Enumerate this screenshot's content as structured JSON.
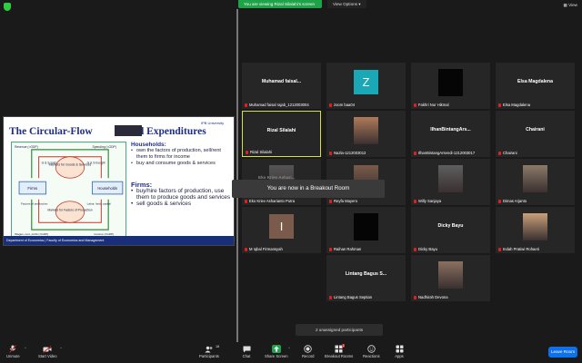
{
  "top": {
    "viewing_banner": "You are viewing Rizal Silalahi's screen",
    "view_options": "View Options",
    "view_button": "View"
  },
  "slide": {
    "title_left": "The Circular-Flow",
    "title_right": "and Expenditures",
    "logo_text": "IPB University",
    "diagram": {
      "revenue": "Revenue (=GDP)",
      "spending": "Spending (=GDP)",
      "gs_sold": "G & S sold",
      "gs_bought": "G & S bought",
      "markets_goods": "Markets for Goods & Services",
      "firms": "Firms",
      "households": "Households",
      "factors_production": "Factors of production",
      "labor": "Labor, land, capital",
      "markets_factors": "Markets for Factors of Production",
      "wages": "Wages, rent, profit (=GDP)",
      "income": "Income (=GDP)"
    },
    "households_title": "Households:",
    "households_bullets": [
      "own the factors of production, sell/rent them to firms for income",
      "buy and consume goods & services"
    ],
    "firms_title": "Firms:",
    "firms_bullets": [
      "buy/hire factors of production, use them to produce goods and services",
      "sell goods & services"
    ],
    "footer": "Department of Economics | Faculty of Economics and Management"
  },
  "tiles": [
    {
      "center": "Muhamad  faisal...",
      "label": "Muhamad faisal rajab_1212003004",
      "kind": "name"
    },
    {
      "center": "Z",
      "label": "zoom baa04",
      "kind": "avatar",
      "color": "#1ba8b6"
    },
    {
      "center": "",
      "label": "Fakhri Nur Hikmal",
      "kind": "black"
    },
    {
      "center": "Elsa Magdalena",
      "label": "Elsa Magdalena",
      "kind": "name"
    },
    {
      "center": "Rizal Silalahi",
      "label": "Rizal Silalahi",
      "kind": "name",
      "active": true
    },
    {
      "center": "",
      "label": "Nazla-1212003013",
      "kind": "photo",
      "color": "#b07a5a"
    },
    {
      "center": "IlhanBintangArs...",
      "label": "IlhanBintangArsendi-1212003017",
      "kind": "name"
    },
    {
      "center": "Chairani",
      "label": "Chairani",
      "kind": "name"
    },
    {
      "center": "",
      "label": "Eko Kriev Asharianto Putra",
      "kind": "photo",
      "color": "#555"
    },
    {
      "center": "",
      "label": "Reyfa Mayero",
      "kind": "photo",
      "color": "#7a5b4a"
    },
    {
      "center": "",
      "label": "Willy Sanjaya",
      "kind": "photo",
      "color": "#5e5e5e"
    },
    {
      "center": "",
      "label": "Dimas Arjanto",
      "kind": "photo",
      "color": "#8a7a68"
    },
    {
      "center": "I",
      "label": "M Iqbal Firmansyah",
      "kind": "avatar",
      "color": "#7a5a4a"
    },
    {
      "center": "",
      "label": "Raihan Rahman",
      "kind": "black"
    },
    {
      "center": "Dicky Bayu",
      "label": "Dicky Bayu",
      "kind": "name"
    },
    {
      "center": "",
      "label": "Indah Pratiwi Rohaeti",
      "kind": "photo",
      "color": "#c9a07a"
    },
    {
      "center": "Lintang Bagus S...",
      "label": "Lintang Bagus Septian",
      "kind": "name"
    },
    {
      "center": "",
      "label": "Nadhirah Devona",
      "kind": "photo",
      "color": "#8a7060"
    }
  ],
  "toast": "You are now in a Breakout Room",
  "toast_ghost": "Eko Kriev Ashari...",
  "unassigned": "2 unassigned participants",
  "toolbar": {
    "unmute": "Unmute",
    "start_video": "Start Video",
    "participants": "Participants",
    "participants_count": "18",
    "chat": "Chat",
    "share_screen": "Share Screen",
    "record": "Record",
    "breakout_rooms": "Breakout Rooms",
    "reactions": "Reactions",
    "apps": "Apps",
    "leave_room": "Leave Room",
    "breakout_badge": "2"
  },
  "colors": {
    "share_green": "#1fa348",
    "leave_blue": "#0e71eb",
    "active_border": "#d4e04a",
    "mic_red": "#e02020"
  }
}
